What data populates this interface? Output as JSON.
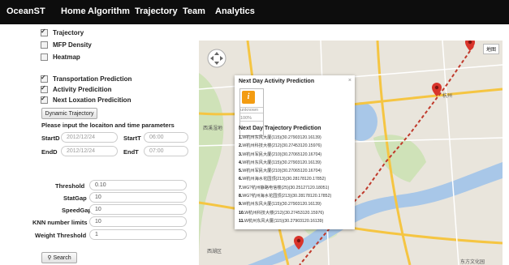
{
  "nav": {
    "brand": "OceanST",
    "items": [
      "Home",
      "Algorithm",
      "Trajectory",
      "Team",
      "Analytics"
    ]
  },
  "checks1": [
    {
      "label": "Trajectory",
      "checked": true
    },
    {
      "label": "MFP Density",
      "checked": false
    },
    {
      "label": "Heatmap",
      "checked": false
    }
  ],
  "checks2": [
    {
      "label": "Transportation Prediction",
      "checked": true
    },
    {
      "label": "Activity Predicition",
      "checked": true
    },
    {
      "label": "Next Loxation Predicition",
      "checked": true
    }
  ],
  "dynamic_button": "Dynamic Trajectory",
  "instruction": "Please input the locaiton and time parameters",
  "params": {
    "startd_label": "StartD",
    "startd_value": "2012/12/24",
    "startt_label": "StartT",
    "startt_value": "06:00",
    "endd_label": "EndD",
    "endd_value": "2012/12/24",
    "endt_label": "EndT",
    "endt_value": "07:00"
  },
  "thresholds": [
    {
      "label": "Threshold",
      "value": "0.10"
    },
    {
      "label": "StatGap",
      "value": "10"
    },
    {
      "label": "SpeedGap",
      "value": "10"
    },
    {
      "label": "KNN number limits",
      "value": "10"
    },
    {
      "label": "Weight Threshold",
      "value": "1"
    }
  ],
  "search_button": "Search",
  "map": {
    "type_button": "地图"
  },
  "popup": {
    "title": "Next Day Activity Prediction",
    "icon": "info-icon",
    "unknown": "unknown",
    "percent": "100%",
    "subtitle": "Next Day Trajectory Prediction",
    "items": [
      {
        "n": "1.",
        "t": "W杭州东风大厦(115)(30.27903120.16139)"
      },
      {
        "n": "2.",
        "t": "W杭州科技大楼(212)(30.27453120.15976)"
      },
      {
        "n": "3.",
        "t": "W杭州军民大厦(210)(30.27065120.16704)"
      },
      {
        "n": "4.",
        "t": "W杭州东风大厦(115)(30.27903120.16139)"
      },
      {
        "n": "5.",
        "t": "W杭州军民大厦(210)(30.27065120.16704)"
      },
      {
        "n": "6.",
        "t": "W杭州海水花园顶(213)(30.28178120.17852)"
      },
      {
        "n": "7.",
        "t": "WG?杭州静路电信楼(25)(30.25127120.18051)"
      },
      {
        "n": "8.",
        "t": "WG?杭州海水花园顶(213)(30.28178120.17852)"
      },
      {
        "n": "9.",
        "t": "W杭州东风大厦(115)(30.27903120.16139)"
      },
      {
        "n": "10.",
        "t": "W杭州科技大楼(212)(30.27453120.15976)"
      },
      {
        "n": "11.",
        "t": "W杭州东风大厦(115)(30.27903120.16139)"
      }
    ]
  },
  "colors": {
    "nav": "#0d0d0d",
    "marker": "#d9342b",
    "route": "#c0392b"
  }
}
